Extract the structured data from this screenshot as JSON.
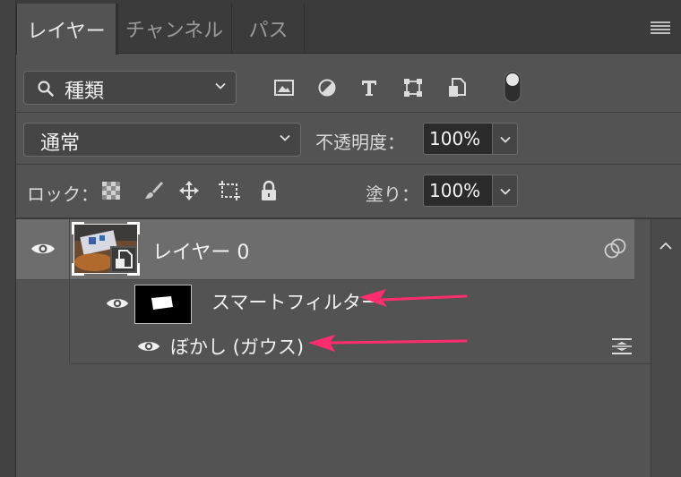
{
  "tabs": [
    {
      "label": "レイヤー",
      "active": true
    },
    {
      "label": "チャンネル",
      "active": false
    },
    {
      "label": "パス",
      "active": false
    }
  ],
  "filter": {
    "kind_label": "種類",
    "icons": [
      "image-filter-icon",
      "adjustment-filter-icon",
      "type-filter-icon",
      "shape-filter-icon",
      "smart-object-filter-icon",
      "filter-toggle-icon"
    ]
  },
  "blend": {
    "mode": "通常",
    "opacity_label": "不透明度：",
    "opacity_value": "100%"
  },
  "lock": {
    "label": "ロック：",
    "fill_label": "塗り：",
    "fill_value": "100%"
  },
  "layers": [
    {
      "name": "レイヤー 0",
      "smart_filter_label": "スマートフィルター",
      "filter_name": "ぼかし (ガウス)"
    }
  ],
  "colors": {
    "annotation_arrow": "#ff2d6f",
    "selected_row": "#6d6d6d",
    "panel_bg": "#535353"
  }
}
